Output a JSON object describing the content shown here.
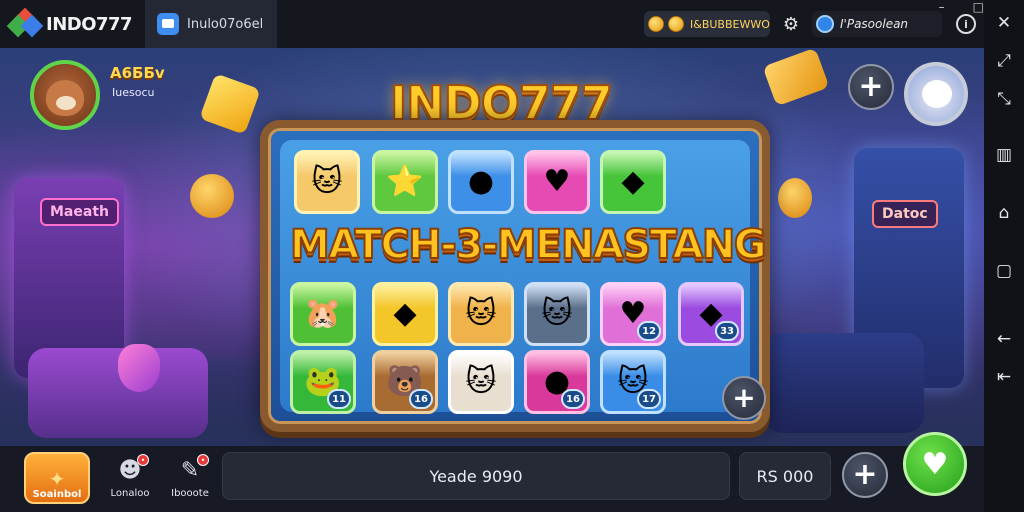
{
  "emulator": {
    "app_title": "INDO777",
    "tab_label": "Inulo07o6el",
    "coin_text": "I&BUBBEWWO",
    "user_text": "I'Pasoolean",
    "info_label": "i",
    "window_controls": [
      "–",
      "□",
      "✕"
    ],
    "right_toolbar": [
      "✕",
      "⤢",
      "⤡",
      "▥",
      "⌂",
      "▢",
      "←",
      "⇤"
    ]
  },
  "game": {
    "logo": "INDO777",
    "headline": "MATCH-3-MENASTANG",
    "player": {
      "name": "A6ƂƂv",
      "sub": "Iuesocu"
    },
    "signs": {
      "left": "Maeath",
      "right": "Datoc"
    },
    "tiles": [
      {
        "glyph": "🐱",
        "badge": "",
        "bg": "#f5c96a",
        "border": "#fff2b5"
      },
      {
        "glyph": "⭐",
        "badge": "",
        "bg": "#5fc83e",
        "border": "#c9f5a0"
      },
      {
        "glyph": "●",
        "badge": "",
        "bg": "#3d8fe8",
        "border": "#bfe1ff"
      },
      {
        "glyph": "♥",
        "badge": "",
        "bg": "#e64bb3",
        "border": "#ffc3ea"
      },
      {
        "glyph": "◆",
        "badge": "",
        "bg": "#46c43a",
        "border": "#c4f5b2"
      },
      {
        "glyph": "🐹",
        "badge": "",
        "bg": "#4fc036",
        "border": "#c9f5a0"
      },
      {
        "glyph": "◆",
        "badge": "",
        "bg": "#f3c629",
        "border": "#fff1a0"
      },
      {
        "glyph": "🐱",
        "badge": "",
        "bg": "#f0b24a",
        "border": "#ffe8b0"
      },
      {
        "glyph": "🐱",
        "badge": "",
        "bg": "#5a6f8a",
        "border": "#cfe0f5"
      },
      {
        "glyph": "♥",
        "badge": "12",
        "bg": "#e070d8",
        "border": "#ffd0f5"
      },
      {
        "glyph": "◆",
        "badge": "33",
        "bg": "#9b4be0",
        "border": "#e3c8ff"
      },
      {
        "glyph": "🐸",
        "badge": "11",
        "bg": "#35b83a",
        "border": "#bff0a8"
      },
      {
        "glyph": "🐻",
        "badge": "16",
        "bg": "#a86b32",
        "border": "#f0cf9e"
      },
      {
        "glyph": "🐱",
        "badge": "",
        "bg": "#e9dfd0",
        "border": "#ffffff"
      },
      {
        "glyph": "●",
        "badge": "16",
        "bg": "#d9399a",
        "border": "#ffc0e4"
      },
      {
        "glyph": "🐱",
        "badge": "17",
        "bg": "#3a8de6",
        "border": "#bfe0ff"
      }
    ]
  },
  "bottom_bar": {
    "main_label": "Soainbol",
    "item2_label": "Lonaloo",
    "item3_label": "Ibooote",
    "bet_text": "Yeade 9090",
    "balance_text": "RS 000"
  },
  "colors": {
    "accent_green": "#2fb52a",
    "logo_gold": "#ffcc2a",
    "frame_wood": "#8a5a2f"
  }
}
